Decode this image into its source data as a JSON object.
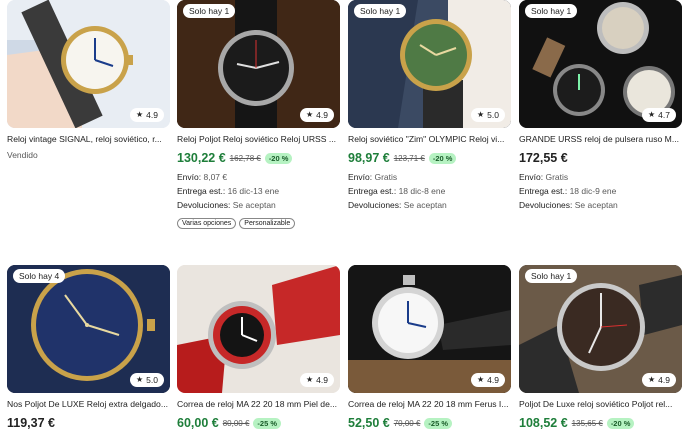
{
  "listings": [
    {
      "title": "Reloj vintage SIGNAL, reloj soviético, r...",
      "status": "Vendido",
      "rating": "4.9"
    },
    {
      "badge": "Solo hay 1",
      "rating": "4.9",
      "title": "Reloj Poljot Reloj soviético Reloj URSS ...",
      "price": "130,22 €",
      "old_price": "162,78 €",
      "discount": "-20 %",
      "shipping_label": "Envío:",
      "shipping_value": "8,07 €",
      "delivery_label": "Entrega est.:",
      "delivery_value": "16 dic-13 ene",
      "returns_label": "Devoluciones:",
      "returns_value": "Se aceptan",
      "chips": [
        "Varias opciones",
        "Personalizable"
      ]
    },
    {
      "badge": "Solo hay 1",
      "rating": "5.0",
      "title": "Reloj soviético \"Zim\" OLYMPIC Reloj vi...",
      "price": "98,97 €",
      "old_price": "123,71 €",
      "discount": "-20 %",
      "shipping_label": "Envío:",
      "shipping_value": "Gratis",
      "delivery_label": "Entrega est.:",
      "delivery_value": "18 dic-8 ene",
      "returns_label": "Devoluciones:",
      "returns_value": "Se aceptan"
    },
    {
      "badge": "Solo hay 1",
      "rating": "4.7",
      "title": "GRANDE URSS reloj de pulsera ruso M...",
      "price": "172,55 €",
      "shipping_label": "Envío:",
      "shipping_value": "Gratis",
      "delivery_label": "Entrega est.:",
      "delivery_value": "18 dic-9 ene",
      "returns_label": "Devoluciones:",
      "returns_value": "Se aceptan"
    },
    {
      "badge": "Solo hay 4",
      "rating": "5.0",
      "title": "Nos Poljot De LUXE Reloj extra delgado...",
      "price": "119,37 €"
    },
    {
      "rating": "4.9",
      "title": "Correa de reloj MA 22 20 18 mm Piel de...",
      "price": "60,00 €",
      "old_price": "80,00 €",
      "discount": "-25 %"
    },
    {
      "rating": "4.9",
      "title": "Correa de reloj MA 22 20 18 mm Ferus I...",
      "price": "52,50 €",
      "old_price": "70,00 €",
      "discount": "-25 %"
    },
    {
      "badge": "Solo hay 1",
      "rating": "4.9",
      "title": "Poljot De Luxe reloj soviético Poljot rel...",
      "price": "108,52 €",
      "old_price": "135,65 €",
      "discount": "-20 %"
    }
  ],
  "colors": {
    "sale_green": "#1e7e3a",
    "discount_bg": "#b6f2c2"
  },
  "icons": {
    "rating": "star-icon"
  }
}
